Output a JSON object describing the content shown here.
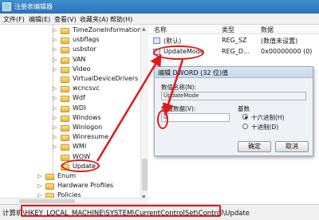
{
  "window": {
    "title": "注册表编辑器"
  },
  "menu": [
    "文件(F)",
    "编辑(E)",
    "查看(V)",
    "收藏夹(A)",
    "帮助(H)"
  ],
  "tree": {
    "items": [
      {
        "label": "TimeZoneInformation",
        "expand": "▷"
      },
      {
        "label": "usbflags",
        "expand": "▷"
      },
      {
        "label": "usbstor",
        "expand": "▷"
      },
      {
        "label": "VAN",
        "expand": "▷"
      },
      {
        "label": "Video",
        "expand": "▷"
      },
      {
        "label": "VirtualDeviceDrivers",
        "expand": ""
      },
      {
        "label": "wcncsvc",
        "expand": "▷"
      },
      {
        "label": "Wdf",
        "expand": "▷"
      },
      {
        "label": "WDI",
        "expand": "▷"
      },
      {
        "label": "Windows",
        "expand": "▷"
      },
      {
        "label": "Winlogon",
        "expand": "▷"
      },
      {
        "label": "Winresume",
        "expand": "▷"
      },
      {
        "label": "WMI",
        "expand": "▷"
      },
      {
        "label": "WOW",
        "expand": ""
      },
      {
        "label": "Update",
        "expand": "",
        "selected": true
      },
      {
        "label": "Enum",
        "expand": "▷"
      },
      {
        "label": "Hardware Profiles",
        "expand": "▷"
      },
      {
        "label": "Policies",
        "expand": "▷"
      }
    ]
  },
  "list": {
    "headers": {
      "name": "名称",
      "type": "类型",
      "data": "数据"
    },
    "rows": [
      {
        "name": "(默认)",
        "type": "REG_SZ",
        "data": "(数值未设置)"
      },
      {
        "name": "UpdateMode",
        "type": "REG_D...",
        "data": "0x00000000 (0)"
      }
    ]
  },
  "dialog": {
    "title": "编辑 DWORD (32 位)值",
    "name_label": "数值名称(N):",
    "name_value": "UpdateMode",
    "data_label": "数值数据(V):",
    "data_value": "0",
    "base_label": "基数",
    "hex_label": "十六进制(H)",
    "dec_label": "十进制(D)",
    "ok_label": "确定",
    "cancel_label": "取消"
  },
  "status": {
    "path": "计算机\\HKEY_LOCAL_MACHINE\\SYSTEM\\CurrentControlSet\\Control\\Update"
  },
  "colors": {
    "annotation": "#e01818",
    "titlebar": "#2a73b8"
  }
}
